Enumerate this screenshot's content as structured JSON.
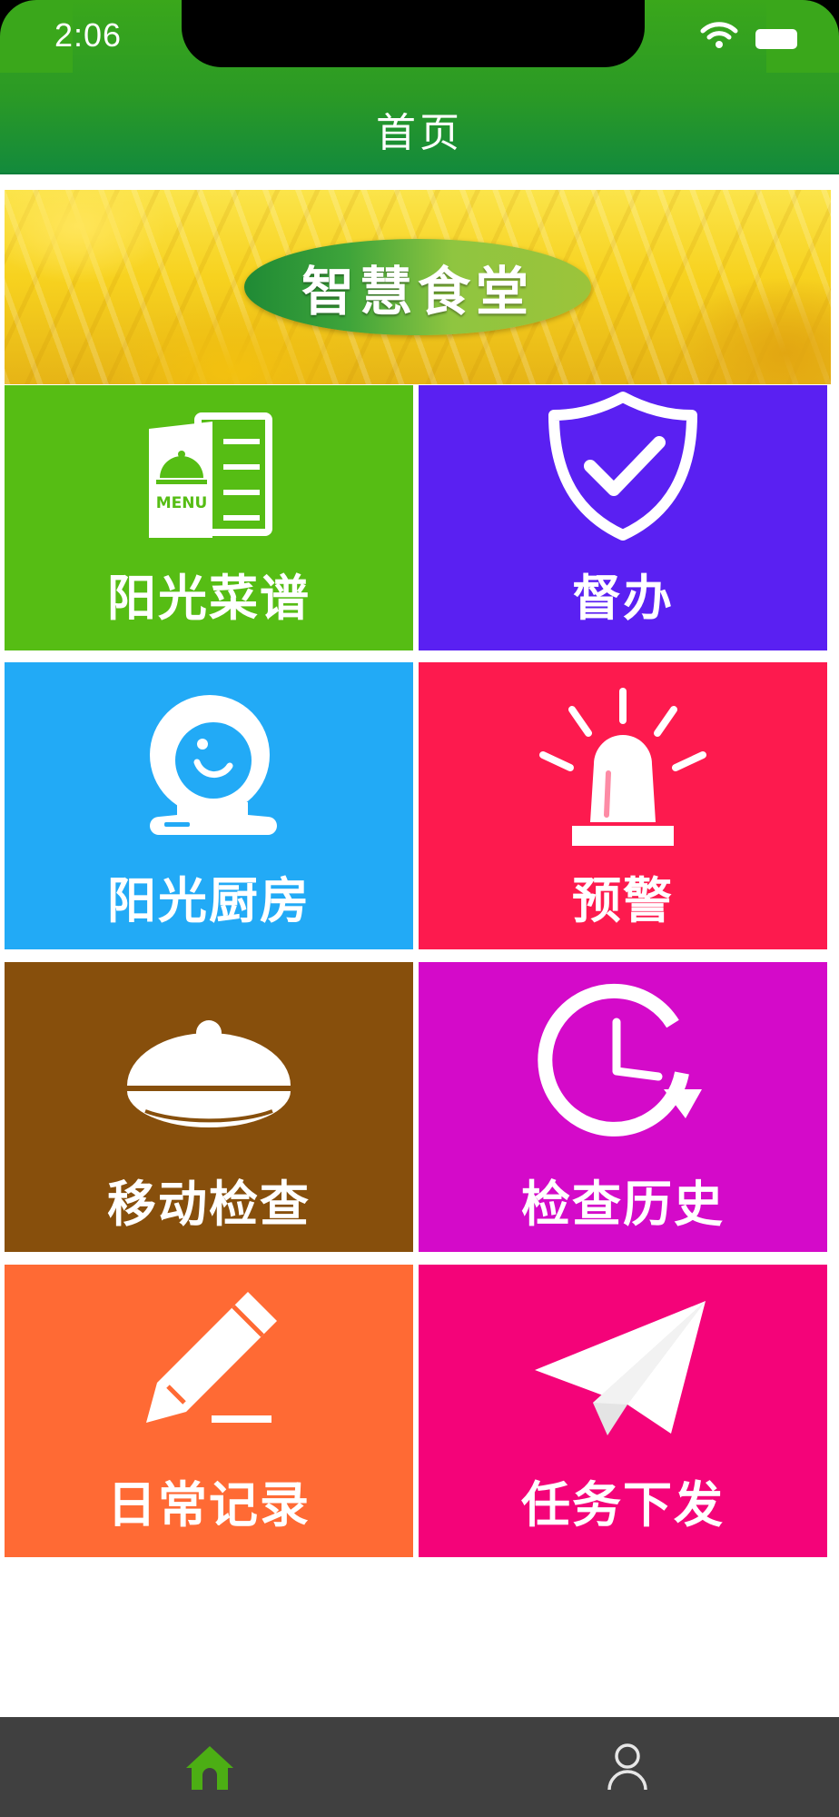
{
  "status_bar": {
    "time": "2:06",
    "wifi_icon": "wifi-icon",
    "battery_icon": "battery-icon"
  },
  "nav": {
    "title": "首页"
  },
  "banner": {
    "logo_text": "智慧食堂"
  },
  "tiles": [
    {
      "label": "阳光菜谱",
      "icon": "menu-icon",
      "color": "#56bd14"
    },
    {
      "label": "督办",
      "icon": "shield-check-icon",
      "color": "#5a20f2"
    },
    {
      "label": "阳光厨房",
      "icon": "webcam-icon",
      "color": "#22aaf6"
    },
    {
      "label": "预警",
      "icon": "alarm-siren-icon",
      "color": "#fd1a4e"
    },
    {
      "label": "移动检查",
      "icon": "dish-cover-icon",
      "color": "#874f0c"
    },
    {
      "label": "检查历史",
      "icon": "clock-history-icon",
      "color": "#d40ac9"
    },
    {
      "label": "日常记录",
      "icon": "pencil-icon",
      "color": "#ff6a34"
    },
    {
      "label": "任务下发",
      "icon": "paper-plane-icon",
      "color": "#f40379"
    }
  ],
  "tabbar": {
    "items": [
      {
        "icon": "home-icon",
        "active": true,
        "color": "#4cae14"
      },
      {
        "icon": "user-icon",
        "active": false,
        "color": "#e6e6e6"
      }
    ]
  }
}
